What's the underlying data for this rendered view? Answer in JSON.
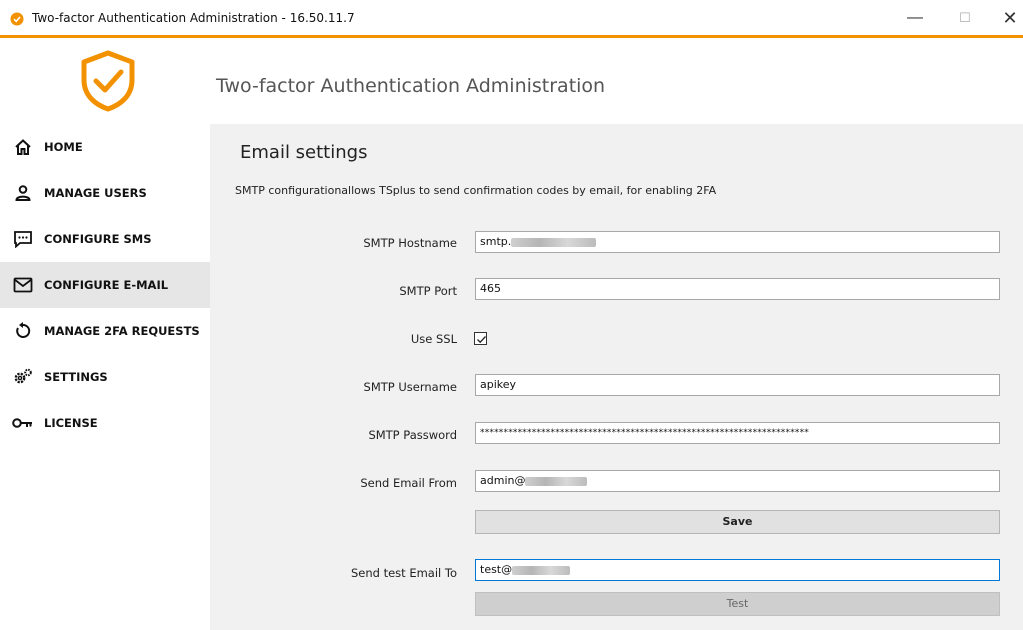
{
  "window": {
    "title": "Two-factor Authentication Administration - 16.50.11.7",
    "minimize": "—",
    "maximize": "☐",
    "close": "✕"
  },
  "header": {
    "title": "Two-factor Authentication Administration",
    "logo_icon": "shield-check-icon",
    "accent_color": "#f39200"
  },
  "sidebar": {
    "items": [
      {
        "label": "HOME",
        "icon": "home-icon",
        "active": false
      },
      {
        "label": "MANAGE USERS",
        "icon": "user-icon",
        "active": false
      },
      {
        "label": "CONFIGURE SMS",
        "icon": "sms-icon",
        "active": false
      },
      {
        "label": "CONFIGURE E-MAIL",
        "icon": "mail-icon",
        "active": true
      },
      {
        "label": "MANAGE 2FA REQUESTS",
        "icon": "refresh-icon",
        "active": false
      },
      {
        "label": "SETTINGS",
        "icon": "gear-icon",
        "active": false
      },
      {
        "label": "LICENSE",
        "icon": "key-icon",
        "active": false
      }
    ]
  },
  "main": {
    "title": "Email settings",
    "description": "SMTP configurationallows TSplus to send confirmation codes by email, for enabling 2FA",
    "fields": {
      "hostname": {
        "label": "SMTP Hostname",
        "value": "smtp."
      },
      "port": {
        "label": "SMTP Port",
        "value": "465"
      },
      "ssl": {
        "label": "Use SSL",
        "checked": true
      },
      "username": {
        "label": "SMTP Username",
        "value": "apikey"
      },
      "password": {
        "label": "SMTP Password",
        "value": "**********************************************************************"
      },
      "from": {
        "label": "Send Email From",
        "value": "admin@"
      },
      "test_to": {
        "label": "Send test Email To",
        "value": "test@"
      }
    },
    "save_label": "Save",
    "test_label": "Test"
  }
}
